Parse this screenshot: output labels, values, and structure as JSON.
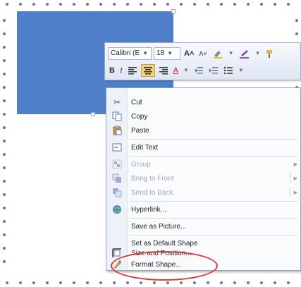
{
  "mini_toolbar": {
    "font_name": "Calibri (E",
    "font_size": "18",
    "grow_font": "A˄",
    "shrink_font": "A˅",
    "bold": "B",
    "italic": "I",
    "font_color": "A"
  },
  "context_menu": {
    "items": [
      {
        "label": "Cut",
        "icon": "scissors-icon",
        "enabled": true
      },
      {
        "label": "Copy",
        "icon": "copy-icon",
        "enabled": true
      },
      {
        "label": "Paste",
        "icon": "paste-icon",
        "enabled": true
      },
      {
        "label": "Edit Text",
        "icon": "edit-text-icon",
        "enabled": true
      },
      {
        "label": "Group",
        "icon": "group-icon",
        "enabled": false,
        "submenu": true
      },
      {
        "label": "Bring to Front",
        "icon": "bring-to-front-icon",
        "enabled": false,
        "submenu": true
      },
      {
        "label": "Send to Back",
        "icon": "send-to-back-icon",
        "enabled": false,
        "submenu": true
      },
      {
        "label": "Hyperlink...",
        "icon": "hyperlink-icon",
        "enabled": true
      },
      {
        "label": "Save as Picture...",
        "icon": "",
        "enabled": true
      },
      {
        "label": "Set as Default Shape",
        "icon": "",
        "enabled": true
      },
      {
        "label": "Size and Position...",
        "icon": "size-position-icon",
        "enabled": true
      },
      {
        "label": "Format Shape...",
        "icon": "format-shape-icon",
        "enabled": true
      }
    ]
  },
  "colors": {
    "shape_fill": "#4f7fc9",
    "highlight_ellipse": "#d83a3a",
    "dot_border": "#6b6fb0"
  }
}
